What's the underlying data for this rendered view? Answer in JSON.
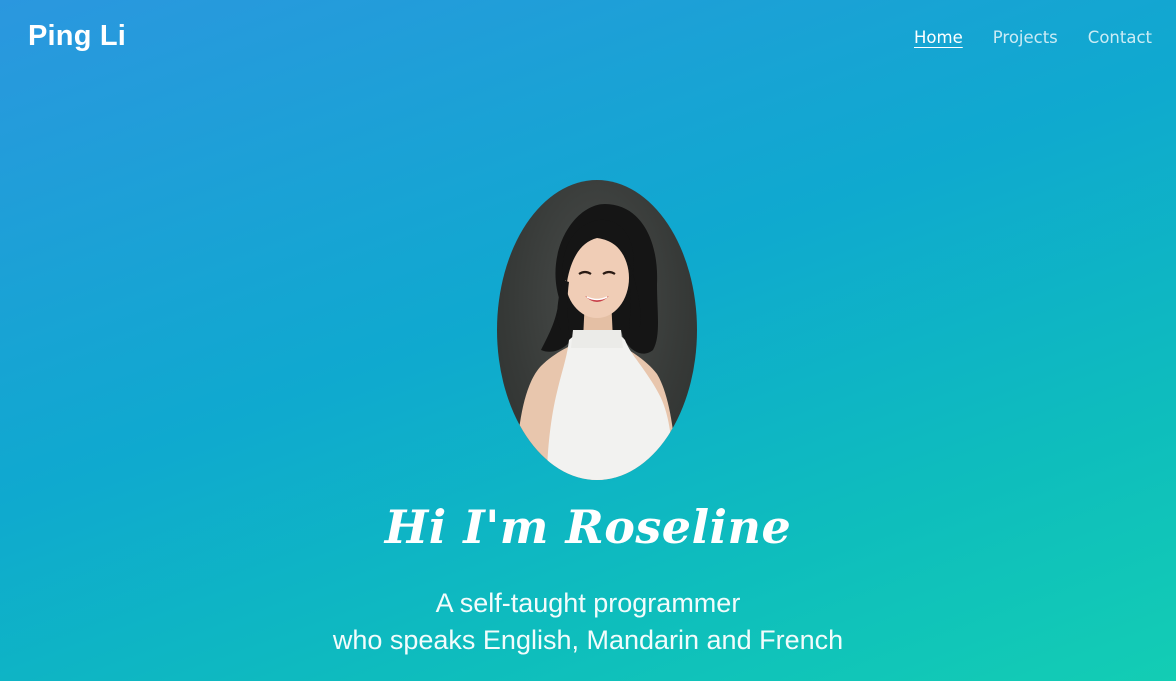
{
  "header": {
    "brand": "Ping Li",
    "nav": [
      {
        "label": "Home",
        "active": true
      },
      {
        "label": "Projects",
        "active": false
      },
      {
        "label": "Contact",
        "active": false
      }
    ]
  },
  "hero": {
    "headline": "Hi I'm Roseline",
    "tagline_line1": "A self-taught programmer",
    "tagline_line2": "who speaks English, Mandarin and French"
  },
  "colors": {
    "gradient_start": "#2b97df",
    "gradient_end": "#13cdb4",
    "text": "#ffffff"
  }
}
